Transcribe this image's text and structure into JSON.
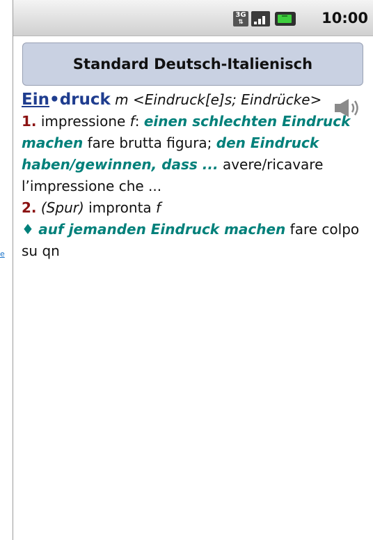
{
  "outer_link_text": "e",
  "status_bar": {
    "network_label": "3G",
    "time": "10:00",
    "icons": [
      "3g-icon",
      "signal-icon",
      "battery-icon"
    ]
  },
  "title": "Standard Deutsch-Italienisch",
  "entry": {
    "headword_underlined": "Ein",
    "headword_dot": "•",
    "headword_rest": "druck",
    "gender": "m",
    "grammar": "<Eindruck[e]s; Eindrücke>",
    "sense1_number": "1.",
    "sense1_translation": "impressione",
    "sense1_gender": "f",
    "sense1_sep": ":",
    "sense1_example1": "einen schlechten Eindruck machen",
    "sense1_trans1": "fare brutta figura;",
    "sense1_example2": "den Eindruck haben/gewinnen, dass ...",
    "sense1_trans2": "avere/ricavare l’impressione che ...",
    "sense2_number": "2.",
    "sense2_label": "(Spur)",
    "sense2_translation": "impronta",
    "sense2_gender": "f",
    "idiom_marker": "♦",
    "idiom_example": "auf jemanden Eindruck machen",
    "idiom_translation": "fare colpo su qn"
  },
  "colors": {
    "headword": "#1f3d8f",
    "sense_number": "#8b1212",
    "example": "#00807a",
    "title_box": "#c9d1e2"
  }
}
